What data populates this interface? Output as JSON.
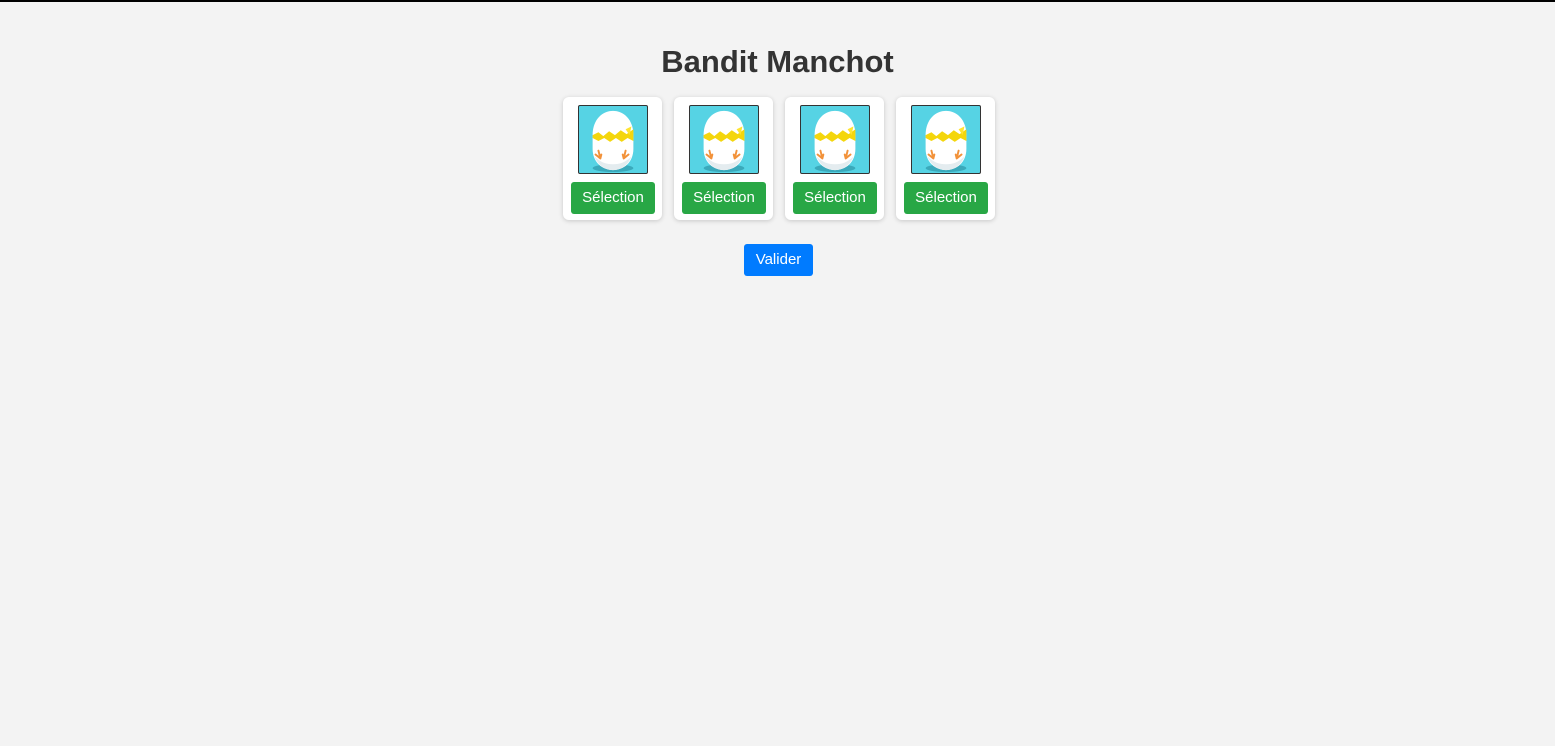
{
  "header": {
    "title": "Bandit Manchot"
  },
  "slots": [
    {
      "icon": "hatching-egg-icon",
      "button_label": "Sélection"
    },
    {
      "icon": "hatching-egg-icon",
      "button_label": "Sélection"
    },
    {
      "icon": "hatching-egg-icon",
      "button_label": "Sélection"
    },
    {
      "icon": "hatching-egg-icon",
      "button_label": "Sélection"
    }
  ],
  "actions": {
    "validate_label": "Valider"
  },
  "colors": {
    "background": "#f3f3f3",
    "select_button": "#28a745",
    "validate_button": "#007bff",
    "slot_background": "#56d3e4"
  }
}
